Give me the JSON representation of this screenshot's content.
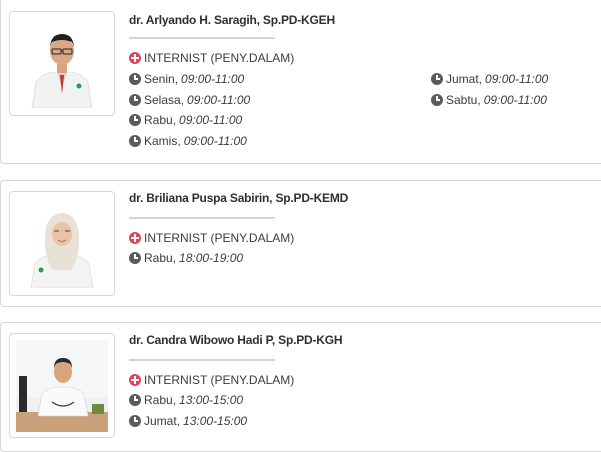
{
  "doctors": [
    {
      "name": "dr. Arlyando H. Saragih, Sp.PD-KGEH",
      "specialty": "INTERNIST (PENY.DALAM)",
      "schedules": [
        {
          "day": "Senin,",
          "time": "09:00-11:00"
        },
        {
          "day": "Selasa,",
          "time": "09:00-11:00"
        },
        {
          "day": "Rabu,",
          "time": "09:00-11:00"
        },
        {
          "day": "Kamis,",
          "time": "09:00-11:00"
        },
        {
          "day": "Jumat,",
          "time": "09:00-11:00"
        },
        {
          "day": "Sabtu,",
          "time": "09:00-11:00"
        }
      ]
    },
    {
      "name": "dr. Briliana Puspa Sabirin, Sp.PD-KEMD",
      "specialty": "INTERNIST (PENY.DALAM)",
      "schedules": [
        {
          "day": "Rabu,",
          "time": "18:00-19:00"
        }
      ]
    },
    {
      "name": "dr. Candra Wibowo Hadi P, Sp.PD-KGH",
      "specialty": "INTERNIST (PENY.DALAM)",
      "schedules": [
        {
          "day": "Rabu,",
          "time": "13:00-15:00"
        },
        {
          "day": "Jumat,",
          "time": "13:00-15:00"
        }
      ]
    }
  ],
  "colors": {
    "specialty_icon": "#e0465a",
    "clock_icon": "#5b5b5b",
    "card_border": "#d6d6d6"
  },
  "icons": {
    "specialty": "plus-circle-icon",
    "schedule": "clock-icon"
  }
}
